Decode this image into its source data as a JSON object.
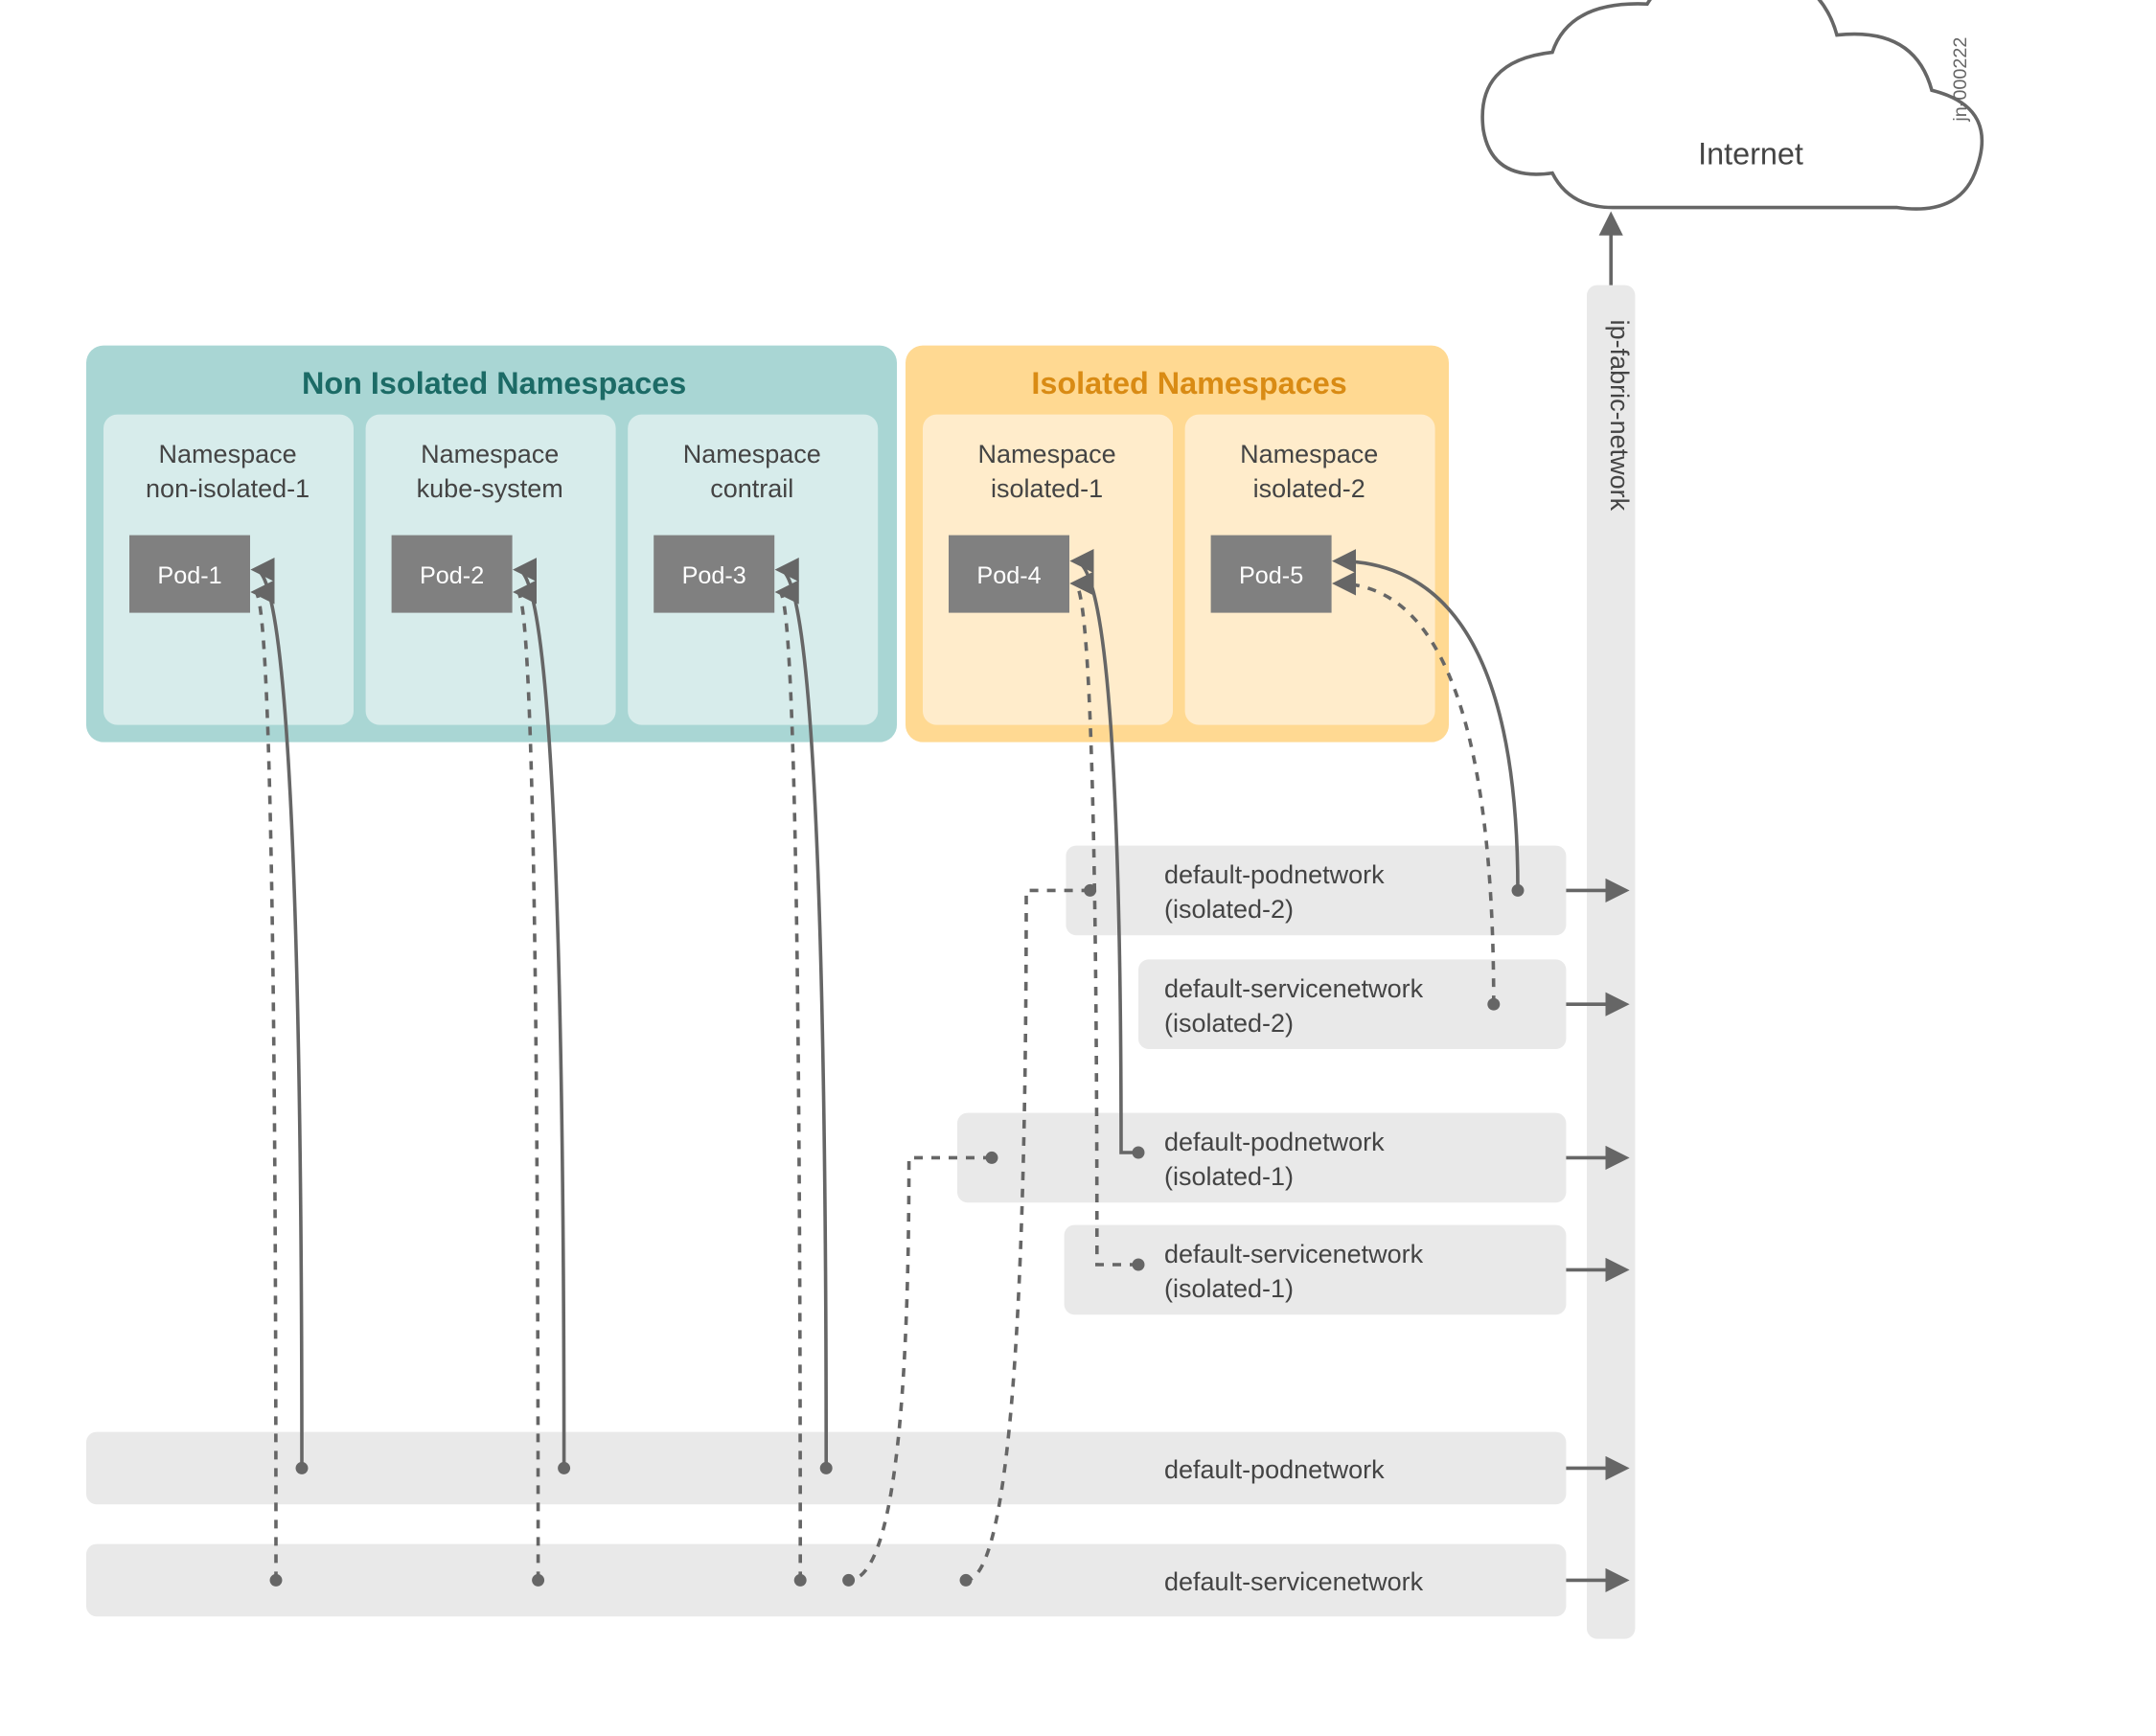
{
  "image_id": "jn-000222",
  "cloud": {
    "label": "Internet"
  },
  "fabric": {
    "label": "ip-fabric-network"
  },
  "groups": {
    "non_isolated": {
      "title": "Non Isolated Namespaces"
    },
    "isolated": {
      "title": "Isolated Namespaces"
    }
  },
  "namespaces": [
    {
      "id": "ns1",
      "line1": "Namespace",
      "line2": "non-isolated-1",
      "pod": "Pod-1"
    },
    {
      "id": "ns2",
      "line1": "Namespace",
      "line2": "kube-system",
      "pod": "Pod-2"
    },
    {
      "id": "ns3",
      "line1": "Namespace",
      "line2": "contrail",
      "pod": "Pod-3"
    },
    {
      "id": "ns4",
      "line1": "Namespace",
      "line2": "isolated-1",
      "pod": "Pod-4"
    },
    {
      "id": "ns5",
      "line1": "Namespace",
      "line2": "isolated-2",
      "pod": "Pod-5"
    }
  ],
  "networks": {
    "iso2_pod": {
      "line1": "default-podnetwork",
      "line2": "(isolated-2)"
    },
    "iso2_svc": {
      "line1": "default-servicenetwork",
      "line2": "(isolated-2)"
    },
    "iso1_pod": {
      "line1": "default-podnetwork",
      "line2": "(isolated-1)"
    },
    "iso1_svc": {
      "line1": "default-servicenetwork",
      "line2": "(isolated-1)"
    },
    "global_pod": {
      "line1": "default-podnetwork",
      "line2": ""
    },
    "global_svc": {
      "line1": "default-servicenetwork",
      "line2": ""
    }
  }
}
